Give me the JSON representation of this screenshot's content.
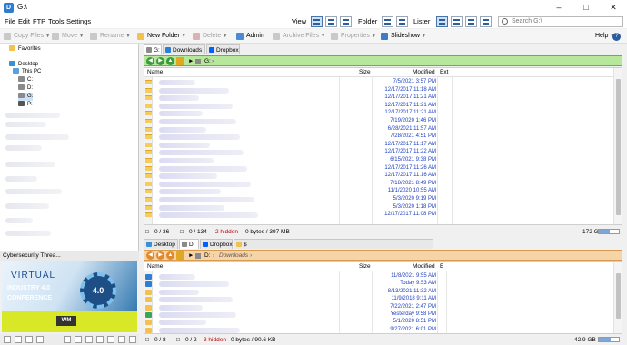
{
  "window": {
    "title": "G:\\"
  },
  "menu": {
    "items": [
      "File",
      "Edit",
      "FTP",
      "Tools",
      "Settings"
    ],
    "view_label": "View",
    "folder_label": "Folder",
    "lister_label": "Lister",
    "search_placeholder": "Search G:\\"
  },
  "toolbar": {
    "copy_files": "Copy Files",
    "move": "Move",
    "rename": "Rename",
    "new_folder": "New Folder",
    "delete": "Delete",
    "admin": "Admin",
    "archive_files": "Archive Files",
    "properties": "Properties",
    "slideshow": "Slideshow",
    "help": "Help"
  },
  "tree": {
    "favorites": "Favorites",
    "desktop": "Desktop",
    "this_pc": "This PC",
    "drives": [
      "C:",
      "D:",
      "G:",
      "P:"
    ]
  },
  "promo": {
    "caption": "Cybersecurity Threa...",
    "line1": "VIRTUAL",
    "line2": "INDUSTRY 4.0",
    "line3": "CONFERENCE",
    "badge": "4.0",
    "logo": "WM"
  },
  "pane_top": {
    "tabs": [
      "G:",
      "Downloads",
      "Dropbox"
    ],
    "path": "G:",
    "columns": {
      "name": "Name",
      "size": "Size",
      "modified": "Modified",
      "ext": "Ext"
    },
    "rows": [
      {
        "modified": "7/5/2021  3:57 PM"
      },
      {
        "modified": "12/17/2017  11:18 AM"
      },
      {
        "modified": "12/17/2017  11:21 AM"
      },
      {
        "modified": "12/17/2017  11:21 AM"
      },
      {
        "modified": "12/17/2017  11:21 AM"
      },
      {
        "modified": "7/19/2020  1:46 PM"
      },
      {
        "modified": "6/28/2021  11:57 AM"
      },
      {
        "modified": "7/28/2021  4:51 PM"
      },
      {
        "modified": "12/17/2017  11:17 AM"
      },
      {
        "modified": "12/17/2017  11:22 AM"
      },
      {
        "modified": "6/15/2021  9:38 PM"
      },
      {
        "modified": "12/17/2017  11:26 AM"
      },
      {
        "modified": "12/17/2017  11:16 AM"
      },
      {
        "modified": "7/18/2021  8:49 PM"
      },
      {
        "modified": "11/1/2020  10:55 AM"
      },
      {
        "modified": "5/3/2020  9:19 PM"
      },
      {
        "modified": "5/3/2020  1:18 PM"
      },
      {
        "modified": "12/17/2017  11:08 PM"
      }
    ],
    "status": {
      "selected": "0 / 36",
      "files": "0 / 134",
      "hidden": "2 hidden",
      "bytes": "0 bytes / 397 MB",
      "free": "172 GB",
      "free_fraction": 0.55
    }
  },
  "pane_bottom": {
    "tabs": [
      "Desktop",
      "D:",
      "Dropbox",
      "$"
    ],
    "path_drive": "D:",
    "path_folder": "Downloads",
    "columns": {
      "name": "Name",
      "size": "Size",
      "modified": "Modified",
      "ext": "E"
    },
    "rows": [
      {
        "modified": "11/8/2021  9:55 AM"
      },
      {
        "modified": "Today  9:53 AM"
      },
      {
        "modified": "8/13/2021  11:32 AM"
      },
      {
        "modified": "11/9/2018  9:11 AM"
      },
      {
        "modified": "7/22/2021  2:47 PM"
      },
      {
        "modified": "Yesterday  9:58 PM"
      },
      {
        "modified": "5/1/2020  8:51 PM"
      },
      {
        "modified": "9/27/2021  6:01 PM"
      }
    ],
    "status": {
      "selected": "0 / 8",
      "files": "0 / 2",
      "hidden": "3 hidden",
      "bytes": "0 bytes / 90.6 KB",
      "free": "42.9 GB",
      "free_fraction": 0.6
    }
  },
  "colors": {
    "accent": "#2b5ea0",
    "green_bar": "#b6e79a",
    "orange_bar": "#f6d4a9",
    "date_blue": "#1f3fbf",
    "hidden_red": "#c00000"
  }
}
